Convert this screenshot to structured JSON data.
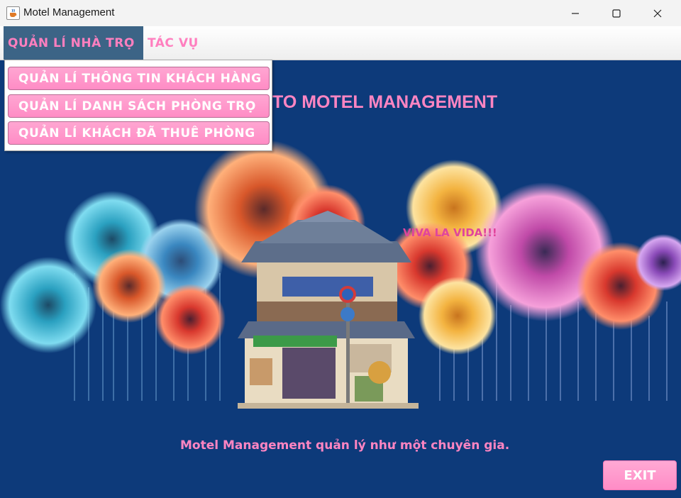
{
  "window": {
    "title": "Motel Management",
    "icon": "java-cup-icon"
  },
  "menubar": {
    "items": [
      {
        "label": "QUẢN LÍ NHÀ TRỌ"
      },
      {
        "label": "TÁC VỤ"
      }
    ]
  },
  "dropdown": {
    "items": [
      {
        "label": "QUẢN LÍ THÔNG TIN KHÁCH HÀNG"
      },
      {
        "label": "QUẢN LÍ DANH SÁCH PHÒNG TRỌ"
      },
      {
        "label": "QUẢN LÍ KHÁCH ĐÃ THUÊ PHÒNG"
      }
    ]
  },
  "main": {
    "title_visible": "TO MOTEL MANAGEMENT",
    "banner_text": "VIVA LA VIDA!!!",
    "tagline": "Motel Management quản lý như một chuyên gia.",
    "exit_label": "EXIT"
  },
  "colors": {
    "background": "#0d3a7a",
    "accent_pink": "#ff85c2",
    "menu_active": "#3c6486"
  }
}
